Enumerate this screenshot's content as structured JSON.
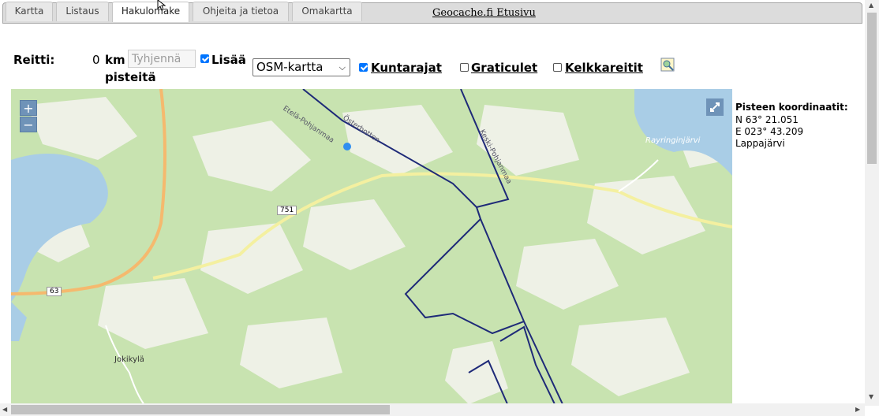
{
  "tabs": [
    {
      "label": "Kartta"
    },
    {
      "label": "Listaus"
    },
    {
      "label": "Hakulomake"
    },
    {
      "label": "Ohjeita ja tietoa"
    },
    {
      "label": "Omakartta"
    }
  ],
  "site_link": "Geocache.fi Etusivu",
  "route": {
    "label": "Reitti:",
    "distance_value": "0",
    "distance_unit": "km",
    "clear_button": "Tyhjennä",
    "add_label": "Lisää",
    "points_label": "pisteitä"
  },
  "map_select": {
    "value": "OSM-kartta"
  },
  "layers": {
    "municipal_borders": "Kuntarajat",
    "graticules": "Graticulet",
    "sled_routes": "Kelkkareitit"
  },
  "map": {
    "zoom_in": "+",
    "zoom_out": "−",
    "labels": {
      "road_751": "751",
      "road_63": "63",
      "village": "Jokikylä",
      "lake": "Rayringinjärvi",
      "region_a": "Etelä-Pohjanmaa",
      "region_b": "Österbotten",
      "region_c": "Keski-Pohjanmaa"
    }
  },
  "coordinates": {
    "title": "Pisteen koordinaatit:",
    "north": "N 63° 21.051",
    "east": "E 023° 43.209",
    "place": "Lappajärvi"
  },
  "colors": {
    "map_green": "#bfe0a6",
    "map_light": "#e9efe0",
    "water": "#a9cde6",
    "border": "#1e2a78",
    "road_yellow": "#f4f0a0",
    "road_orange": "#f5b96e",
    "control_blue": "#6f93b8"
  }
}
